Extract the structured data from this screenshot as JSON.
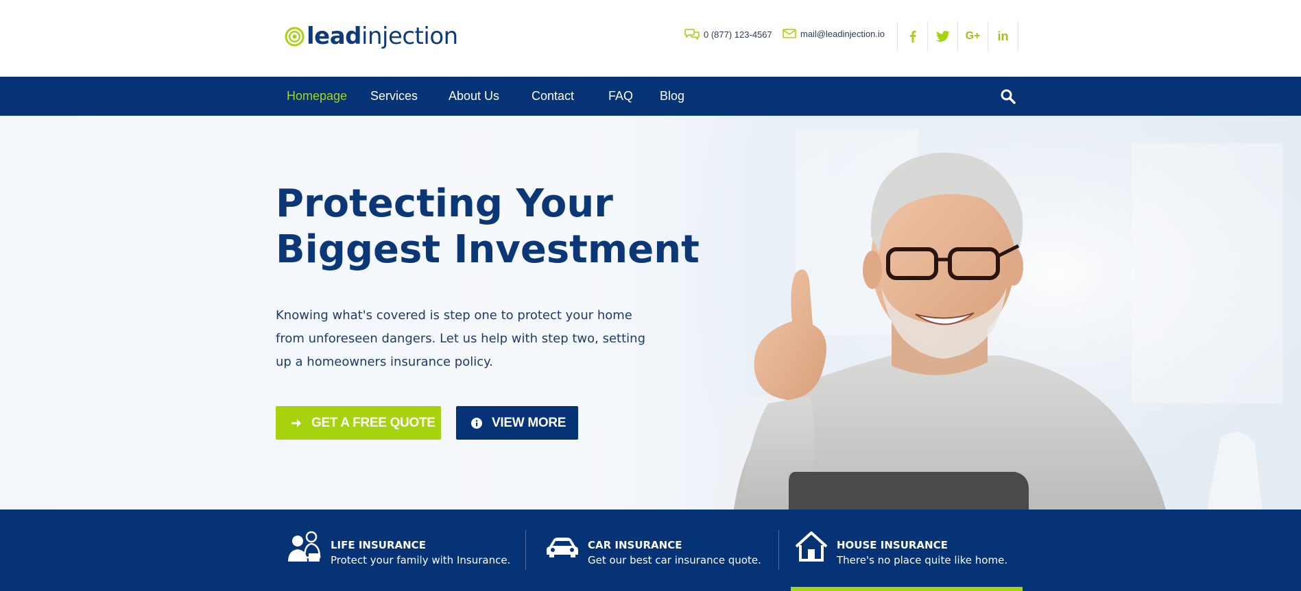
{
  "logo": {
    "bold": "lead",
    "light": "injection"
  },
  "contact": {
    "phone": "0 (877) 123-4567",
    "email": "mail@leadinjection.io"
  },
  "socials": [
    {
      "icon": "facebook-icon",
      "glyph": "f"
    },
    {
      "icon": "twitter-icon",
      "glyph": "t"
    },
    {
      "icon": "google-plus-icon",
      "glyph": "G+"
    },
    {
      "icon": "linkedin-icon",
      "glyph": "in"
    }
  ],
  "nav": {
    "items": [
      "Homepage",
      "Services",
      "About Us",
      "Contact",
      "FAQ",
      "Blog"
    ],
    "active": "Homepage"
  },
  "hero": {
    "title_line1": "Protecting Your",
    "title_line2": "Biggest Investment",
    "text": "Knowing what's covered is step one to protect your home from unforeseen dangers. Let us help with step two, setting up a homeowners insurance policy.",
    "quote_button": "GET A FREE QUOTE",
    "more_button": "VIEW MORE"
  },
  "insurance": [
    {
      "title": "LIFE INSURANCE",
      "subtitle": "Protect your family with Insurance.",
      "icon": "family-icon"
    },
    {
      "title": "CAR INSURANCE",
      "subtitle": "Get our best car insurance quote.",
      "icon": "car-icon"
    },
    {
      "title": "HOUSE INSURANCE",
      "subtitle": "There's no place quite like home.",
      "icon": "house-icon"
    }
  ],
  "colors": {
    "brand_navy": "#063375",
    "accent_green": "#a6d20e",
    "title_blue": "#0b3777"
  }
}
